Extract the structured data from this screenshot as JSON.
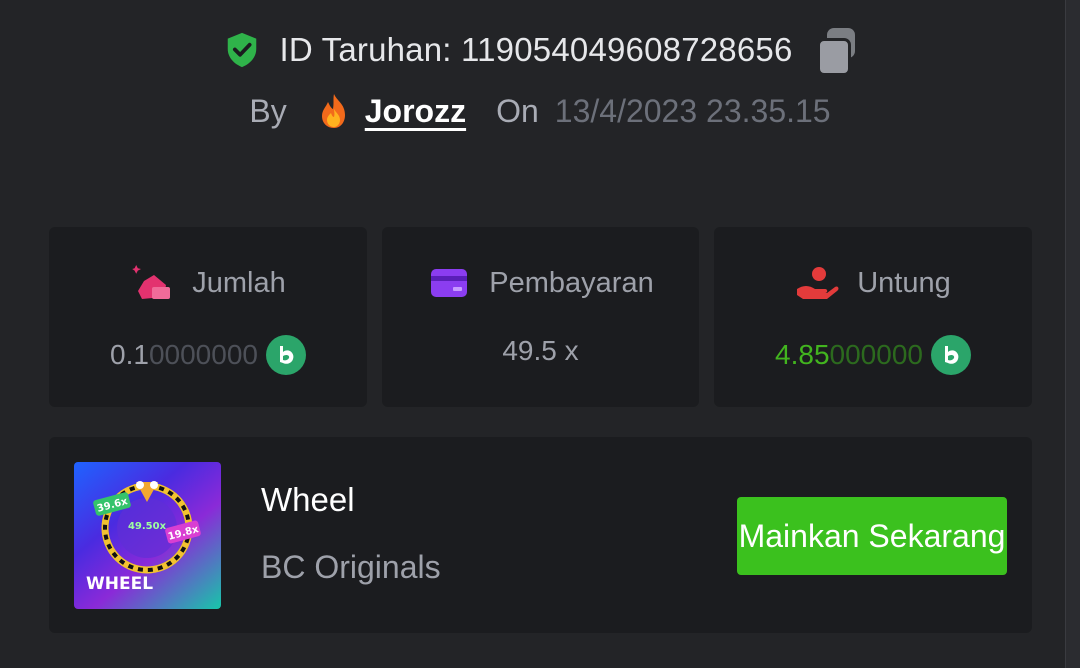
{
  "bet": {
    "id_label": "ID Taruhan: 119054049608728656",
    "by_label": "By",
    "username": "Jorozz",
    "on_label": "On",
    "datetime": "13/4/2023 23.35.15"
  },
  "stats": {
    "amount": {
      "label": "Jumlah",
      "value_main": "0.1",
      "value_faint": "0000000"
    },
    "payout": {
      "label": "Pembayaran",
      "value": "49.5 x"
    },
    "profit": {
      "label": "Untung",
      "value_main": "4.85",
      "value_faint": "000000"
    }
  },
  "game": {
    "title": "Wheel",
    "provider": "BC Originals",
    "play_label": "Mainkan Sekarang",
    "thumb": {
      "name": "WHEEL",
      "mult_left": "39.6x",
      "mult_center": "49.50x",
      "mult_right": "19.8x"
    }
  },
  "colors": {
    "accent_green": "#3bc11e",
    "profit_green": "#42b41f",
    "coin": "#2ba56a",
    "shield": "#2fb34a",
    "amount_icon": "#e3326f",
    "payout_icon": "#8b3df0",
    "profit_icon": "#e33b3b"
  },
  "icons": {
    "verified": "shield-check-icon",
    "copy": "copy-icon",
    "user": "flame-icon",
    "amount": "money-bag-icon",
    "payout": "card-icon",
    "profit": "hand-coin-icon",
    "currency": "bc-coin-icon"
  }
}
